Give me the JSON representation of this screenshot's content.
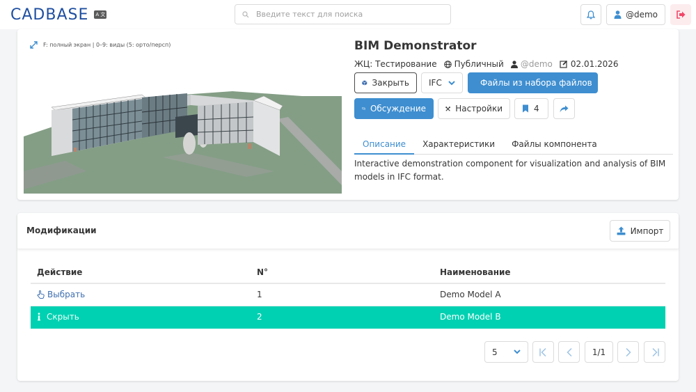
{
  "app": {
    "logo_text": "CADBASE",
    "lang_badge": "A 文"
  },
  "header": {
    "search_placeholder": "Введите текст для поиска",
    "notifications_icon": "bell-icon",
    "user_label": "@demo",
    "logout_icon": "logout-icon"
  },
  "viewer": {
    "hint": "F: полный экран | 0–9: виды (5: орто/персп)"
  },
  "component": {
    "title": "BIM Demonstrator",
    "category": "ЖЦ: Тестирование",
    "visibility": "Публичный",
    "owner": "@demo",
    "date": "02.01.2026",
    "buttons": {
      "close": "Закрыть",
      "format": "IFC",
      "fileset_files": "Файлы из набора файлов",
      "discussion": "Обсуждение",
      "settings": "Настройки",
      "bookmarks_count": "4"
    },
    "tabs": [
      "Описание",
      "Характеристики",
      "Файлы компонента"
    ],
    "active_tab": "Описание",
    "description": "Interactive demonstration component for visualization and analysis of BIM models in IFC format."
  },
  "modifications": {
    "title": "Модификации",
    "import_label": "Импорт",
    "columns": [
      "Действие",
      "N°",
      "Наименование"
    ],
    "rows": [
      {
        "action": "Выбрать",
        "num": "1",
        "name": "Demo Model A",
        "selected": false
      },
      {
        "action": "Скрыть",
        "num": "2",
        "name": "Demo Model B",
        "selected": true
      }
    ],
    "page_size": "5",
    "page": "1/1"
  },
  "colors": {
    "primary": "#3e8ed0",
    "selected_row": "#00d1b2",
    "brand": "#1f4fa0"
  }
}
